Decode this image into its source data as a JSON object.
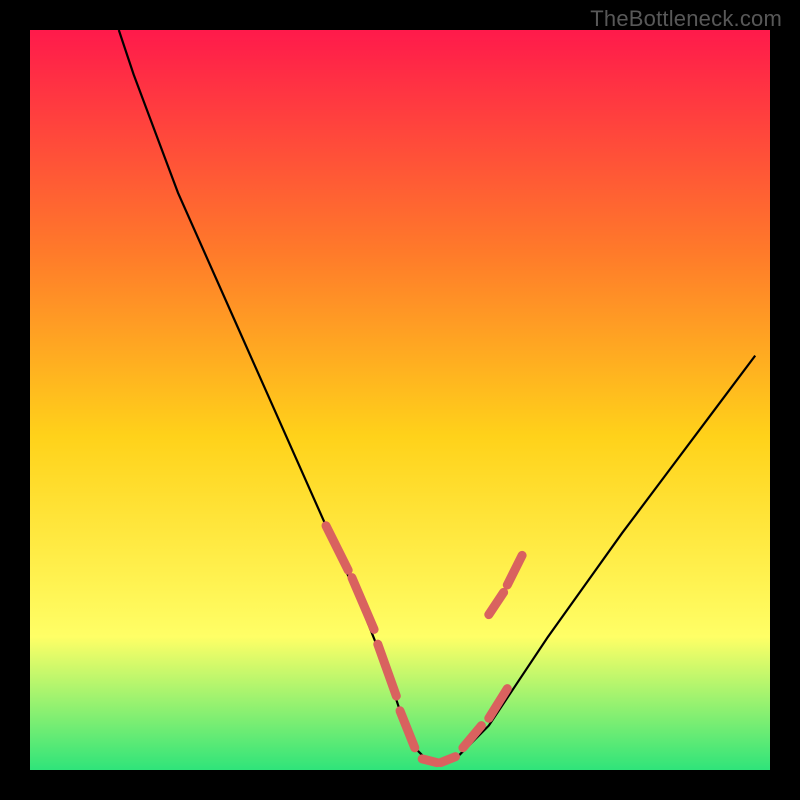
{
  "watermark": "TheBottleneck.com",
  "chart_data": {
    "type": "line",
    "title": "",
    "xlabel": "",
    "ylabel": "",
    "xlim": [
      0,
      100
    ],
    "ylim": [
      0,
      100
    ],
    "grid": false,
    "legend": false,
    "background_gradient": {
      "top": "#ff1a4b",
      "mid_upper": "#ff7a2a",
      "mid": "#ffd21a",
      "mid_lower": "#ffff66",
      "bottom": "#2fe47a"
    },
    "series": [
      {
        "name": "boundary-curve",
        "stroke": "#000000",
        "x": [
          12,
          14,
          17,
          20,
          24,
          28,
          32,
          36,
          40,
          44,
          48,
          50,
          52,
          54,
          56,
          58,
          62,
          66,
          70,
          75,
          80,
          86,
          92,
          98
        ],
        "y": [
          100,
          94,
          86,
          78,
          69,
          60,
          51,
          42,
          33,
          24,
          14,
          8,
          3,
          1,
          1,
          2,
          6,
          12,
          18,
          25,
          32,
          40,
          48,
          56
        ]
      },
      {
        "name": "highlight-dashes",
        "stroke": "#d9625f",
        "segments": [
          {
            "x": [
              40,
              43
            ],
            "y": [
              33,
              27
            ]
          },
          {
            "x": [
              43.5,
              46.5
            ],
            "y": [
              26,
              19
            ]
          },
          {
            "x": [
              47,
              49.5
            ],
            "y": [
              17,
              10
            ]
          },
          {
            "x": [
              50,
              52
            ],
            "y": [
              8,
              3
            ]
          },
          {
            "x": [
              53,
              55
            ],
            "y": [
              1.5,
              1
            ]
          },
          {
            "x": [
              55.5,
              57.5
            ],
            "y": [
              1,
              1.8
            ]
          },
          {
            "x": [
              58.5,
              61
            ],
            "y": [
              3,
              6
            ]
          },
          {
            "x": [
              62,
              64.5
            ],
            "y": [
              7,
              11
            ]
          },
          {
            "x": [
              62,
              64
            ],
            "y": [
              21,
              24
            ]
          },
          {
            "x": [
              64.5,
              66.5
            ],
            "y": [
              25,
              29
            ]
          }
        ]
      }
    ]
  }
}
